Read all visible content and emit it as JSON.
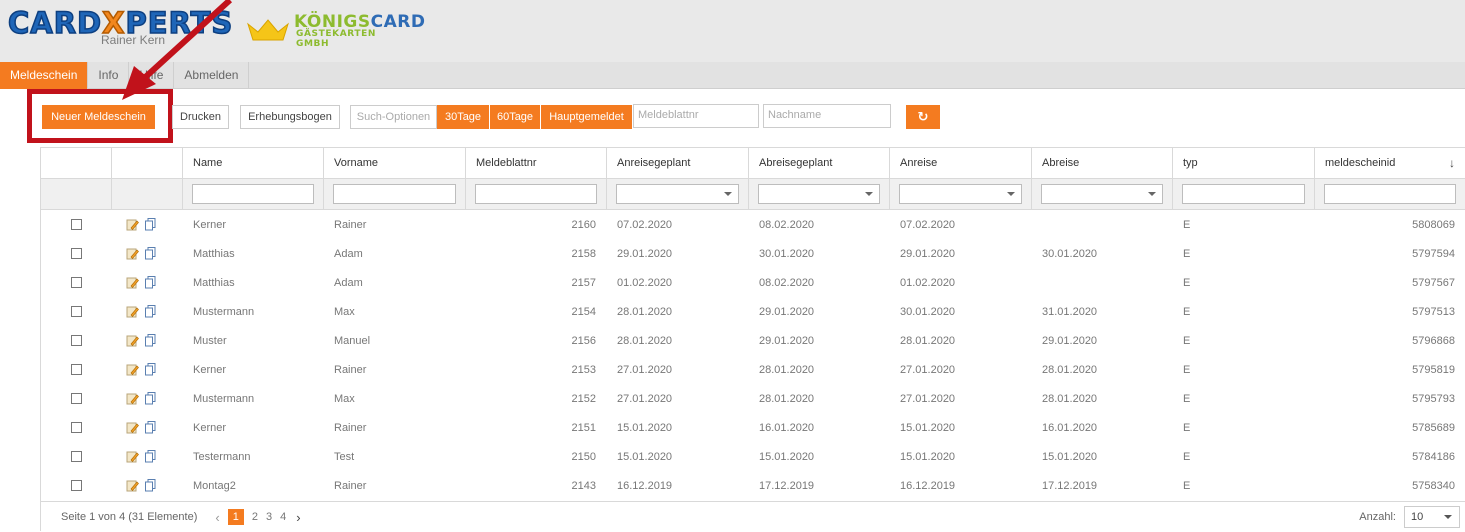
{
  "colors": {
    "accent": "#f47b20",
    "highlight": "#c1121b",
    "brand_blue": "#1f66b8",
    "brand_green": "#8dbb2f"
  },
  "logo": {
    "cardxperts_a": "CARD",
    "cardxperts_x": "X",
    "cardxperts_b": "PERTS",
    "owner": "Rainer Kern",
    "koenig_a": "KÖNIGS",
    "koenig_b": "CARD",
    "koenig_sub": "GÄSTEKARTEN GMBH"
  },
  "nav": {
    "tabs": [
      "Meldeschein",
      "Info",
      "Hilfe",
      "Abmelden"
    ],
    "active": "Meldeschein"
  },
  "toolbar": {
    "new": "Neuer Meldeschein",
    "print": "Drucken",
    "survey": "Erhebungsbogen",
    "search_options": "Such-Optionen",
    "d30": "30Tage",
    "d60": "60Tage",
    "main": "Hauptgemeldet",
    "sheet_placeholder": "Meldeblattnr",
    "name_placeholder": "Nachname",
    "refresh_icon": "refresh-icon"
  },
  "grid": {
    "columns": [
      "",
      "",
      "Name",
      "Vorname",
      "Meldeblattnr",
      "Anreisegeplant",
      "Abreisegeplant",
      "Anreise",
      "Abreise",
      "typ",
      "meldescheinid"
    ],
    "sort_indicator": "↓",
    "rows": [
      [
        "Kerner",
        "Rainer",
        "2160",
        "07.02.2020",
        "08.02.2020",
        "07.02.2020",
        "",
        "E",
        "5808069"
      ],
      [
        "Matthias",
        "Adam",
        "2158",
        "29.01.2020",
        "30.01.2020",
        "29.01.2020",
        "30.01.2020",
        "E",
        "5797594"
      ],
      [
        "Matthias",
        "Adam",
        "2157",
        "01.02.2020",
        "08.02.2020",
        "01.02.2020",
        "",
        "E",
        "5797567"
      ],
      [
        "Mustermann",
        "Max",
        "2154",
        "28.01.2020",
        "29.01.2020",
        "30.01.2020",
        "31.01.2020",
        "E",
        "5797513"
      ],
      [
        "Muster",
        "Manuel",
        "2156",
        "28.01.2020",
        "29.01.2020",
        "28.01.2020",
        "29.01.2020",
        "E",
        "5796868"
      ],
      [
        "Kerner",
        "Rainer",
        "2153",
        "27.01.2020",
        "28.01.2020",
        "27.01.2020",
        "28.01.2020",
        "E",
        "5795819"
      ],
      [
        "Mustermann",
        "Max",
        "2152",
        "27.01.2020",
        "28.01.2020",
        "27.01.2020",
        "28.01.2020",
        "E",
        "5795793"
      ],
      [
        "Kerner",
        "Rainer",
        "2151",
        "15.01.2020",
        "16.01.2020",
        "15.01.2020",
        "16.01.2020",
        "E",
        "5785689"
      ],
      [
        "Testermann",
        "Test",
        "2150",
        "15.01.2020",
        "15.01.2020",
        "15.01.2020",
        "15.01.2020",
        "E",
        "5784186"
      ],
      [
        "Montag2",
        "Rainer",
        "2143",
        "16.12.2019",
        "17.12.2019",
        "16.12.2019",
        "17.12.2019",
        "E",
        "5758340"
      ]
    ]
  },
  "pager": {
    "info": "Seite 1 von 4 (31 Elemente)",
    "pages": [
      "1",
      "2",
      "3",
      "4"
    ],
    "current": "1",
    "prev": "‹",
    "next": "›",
    "count_label": "Anzahl:",
    "count_value": "10"
  }
}
